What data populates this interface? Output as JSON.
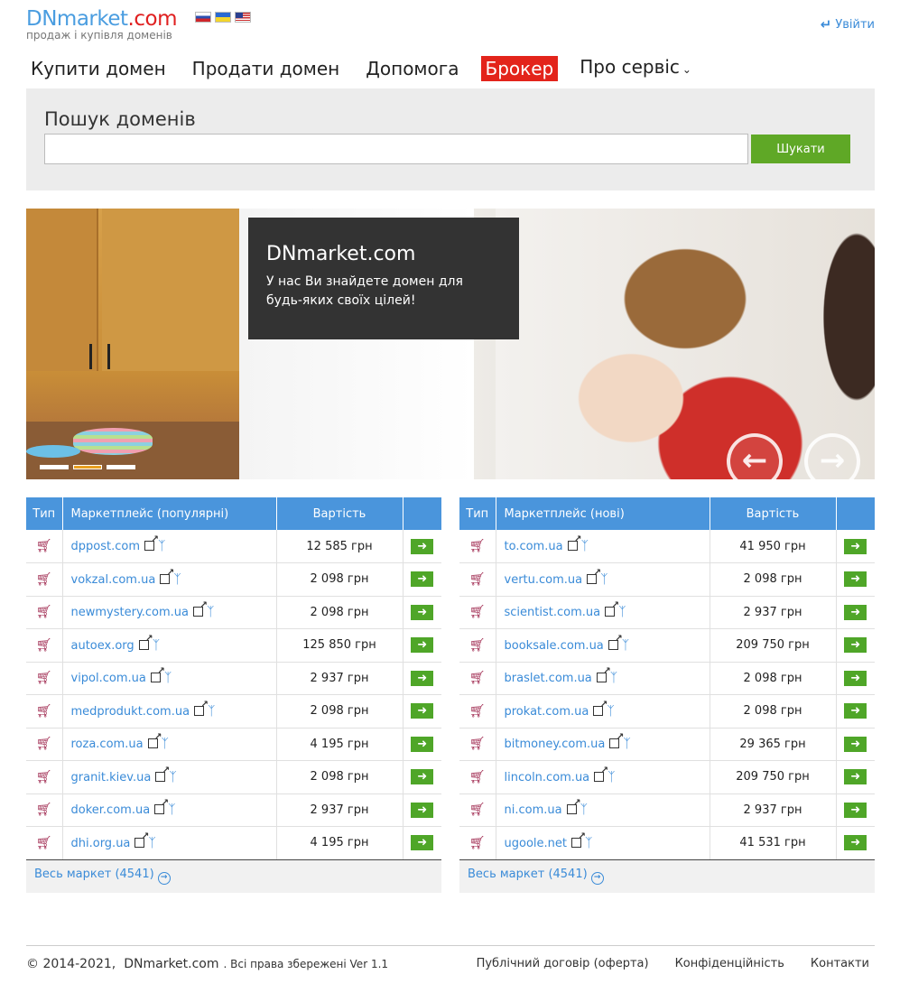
{
  "header": {
    "logo_dn": "DNmarket",
    "logo_com": ".com",
    "tagline": "продаж і купівля доменів",
    "login_label": "Увійти",
    "flags": [
      "flag-ru-icon",
      "flag-ua-icon",
      "flag-us-icon"
    ]
  },
  "nav": {
    "items": [
      {
        "label": "Купити домен"
      },
      {
        "label": "Продати домен"
      },
      {
        "label": "Допомога"
      },
      {
        "label": "Брокер"
      },
      {
        "label": "Про сервіс"
      }
    ]
  },
  "search": {
    "title": "Пошук доменів",
    "value": "",
    "button_label": "Шукати"
  },
  "banner": {
    "title": "DNmarket.com",
    "text": "У нас Ви знайдете домен для будь-яких своїх цілей!",
    "active_slide": 2
  },
  "popular": {
    "headers": [
      "Тип",
      "Маркетплейс (популярні)",
      "Вартість",
      ""
    ],
    "rows": [
      {
        "domain": "dppost.com",
        "price": "12 585 грн"
      },
      {
        "domain": "vokzal.com.ua",
        "price": "2 098 грн"
      },
      {
        "domain": "newmystery.com.ua",
        "price": "2 098 грн"
      },
      {
        "domain": "autoex.org",
        "price": "125 850 грн"
      },
      {
        "domain": "vipol.com.ua",
        "price": "2 937 грн"
      },
      {
        "domain": "medprodukt.com.ua",
        "price": "2 098 грн"
      },
      {
        "domain": "roza.com.ua",
        "price": "4 195 грн"
      },
      {
        "domain": "granit.kiev.ua",
        "price": "2 098 грн"
      },
      {
        "domain": "doker.com.ua",
        "price": "2 937 грн"
      },
      {
        "domain": "dhi.org.ua",
        "price": "4 195 грн"
      }
    ],
    "more_label": "Весь маркет (4541)"
  },
  "new": {
    "headers": [
      "Тип",
      "Маркетплейс (нові)",
      "Вартість",
      ""
    ],
    "rows": [
      {
        "domain": "to.com.ua",
        "price": "41 950 грн"
      },
      {
        "domain": "vertu.com.ua",
        "price": "2 098 грн"
      },
      {
        "domain": "scientist.com.ua",
        "price": "2 937 грн"
      },
      {
        "domain": "booksale.com.ua",
        "price": "209 750 грн"
      },
      {
        "domain": "braslet.com.ua",
        "price": "2 098 грн"
      },
      {
        "domain": "prokat.com.ua",
        "price": "2 098 грн"
      },
      {
        "domain": "bitmoney.com.ua",
        "price": "29 365 грн"
      },
      {
        "domain": "lincoln.com.ua",
        "price": "209 750 грн"
      },
      {
        "domain": "ni.com.ua",
        "price": "2 937 грн"
      },
      {
        "domain": "ugoole.net",
        "price": "41 531 грн"
      }
    ],
    "more_label": "Весь маркет (4541)"
  },
  "footer": {
    "copyright": "© 2014-2021,",
    "brand": "DNmarket.com",
    "rights": ". Всі права збережені Ver 1.1",
    "links": [
      "Публічний договір (оферта)",
      "Конфіденційність",
      "Контакти"
    ]
  },
  "colors": {
    "accent_blue": "#4a95dc",
    "broker_red": "#e3241b",
    "button_green": "#5fa826"
  }
}
